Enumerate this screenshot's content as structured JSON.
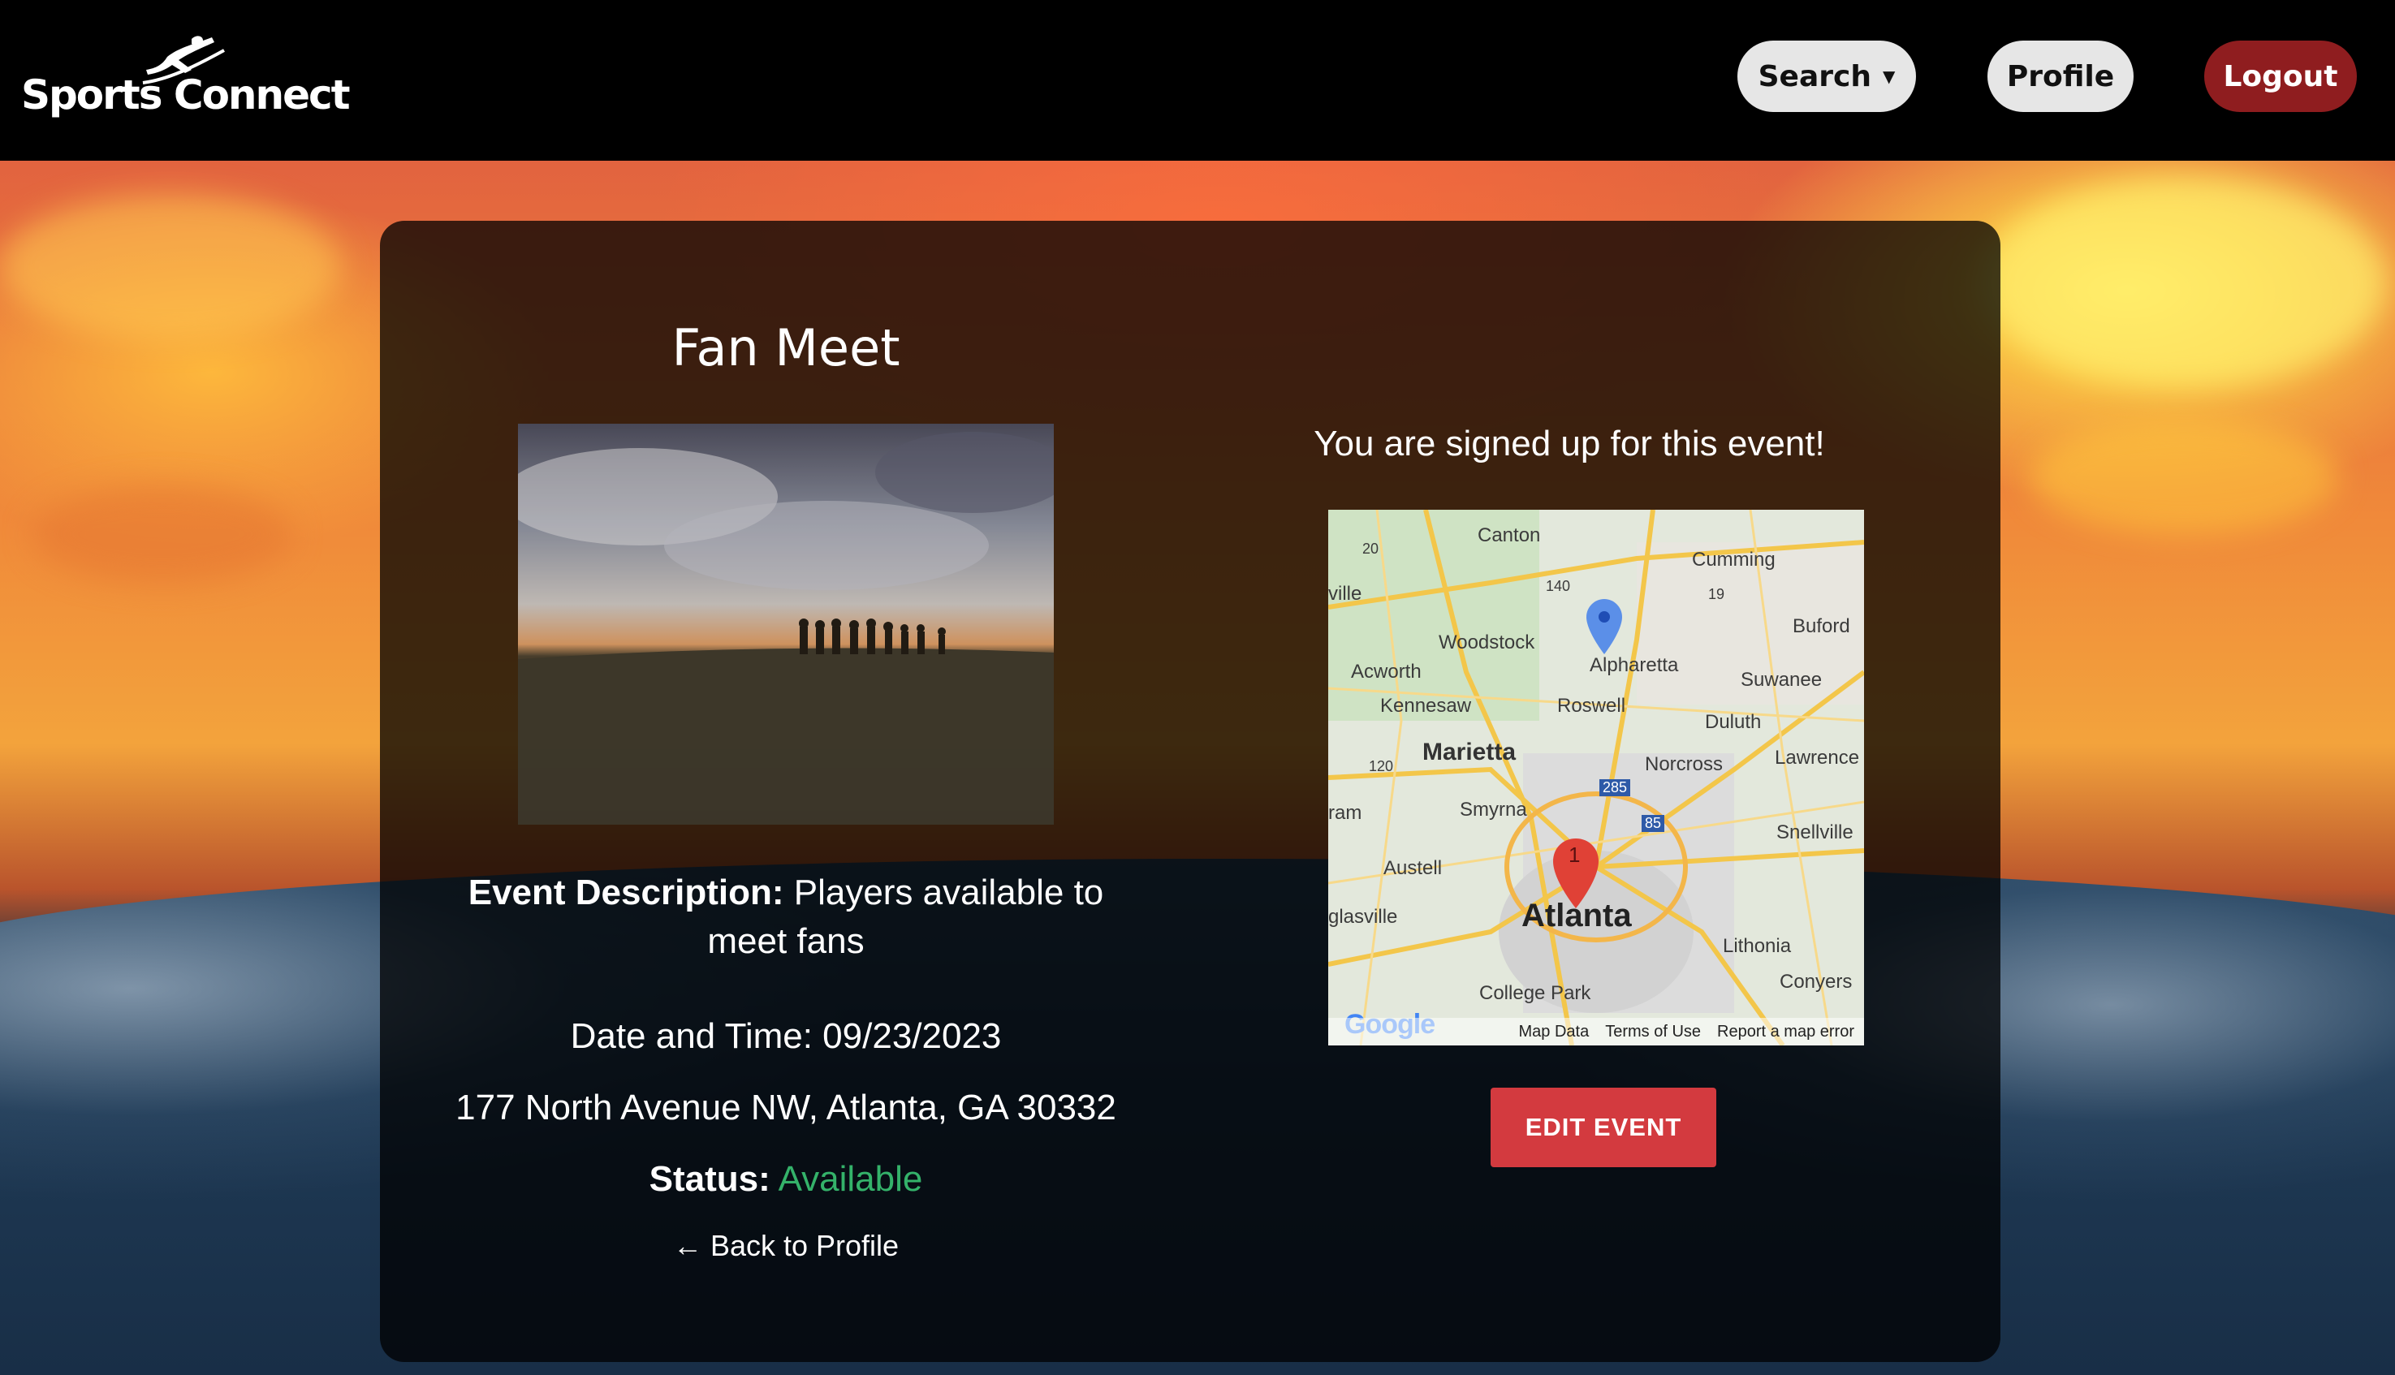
{
  "header": {
    "logo_text": "Sports Connect",
    "nav": {
      "search_label": "Search",
      "search_caret": "▼",
      "profile_label": "Profile",
      "logout_label": "Logout"
    }
  },
  "event": {
    "title": "Fan Meet",
    "description_label": "Event Description:",
    "description": "Players available to meet fans",
    "date_time": "Date and Time: 09/23/2023",
    "address": "177 North Avenue NW, Atlanta, GA 30332",
    "status_label": "Status:",
    "status_value": "Available",
    "back_link": "← Back to Profile"
  },
  "signup": {
    "message": "You are signed up for this event!",
    "edit_button": "EDIT EVENT"
  },
  "map": {
    "places": {
      "canton": "Canton",
      "cumming": "Cumming",
      "ville": "ville",
      "buford": "Buford",
      "woodstock": "Woodstock",
      "alpharetta": "Alpharetta",
      "acworth": "Acworth",
      "suwanee": "Suwanee",
      "kennesaw": "Kennesaw",
      "roswell": "Roswell",
      "duluth": "Duluth",
      "marietta": "Marietta",
      "norcross": "Norcross",
      "lawrence": "Lawrence",
      "smyrna": "Smyrna",
      "ram": "ram",
      "snellville": "Snellville",
      "austell": "Austell",
      "glasville": "glasville",
      "atlanta": "Atlanta",
      "lithonia": "Lithonia",
      "conyers": "Conyers",
      "college_park": "College Park"
    },
    "routes": {
      "r20": "20",
      "r140": "140",
      "r19": "19",
      "r120": "120",
      "r285": "285",
      "r85": "85"
    },
    "marker_label": "1",
    "google_text": "Google",
    "footer": {
      "map_data": "Map Data",
      "terms": "Terms of Use",
      "report": "Report a map error"
    }
  },
  "colors": {
    "header_bg": "#000000",
    "logout_bg": "#8f1d1f",
    "edit_button_bg": "#d33a3f",
    "status_available": "#34b26a"
  }
}
